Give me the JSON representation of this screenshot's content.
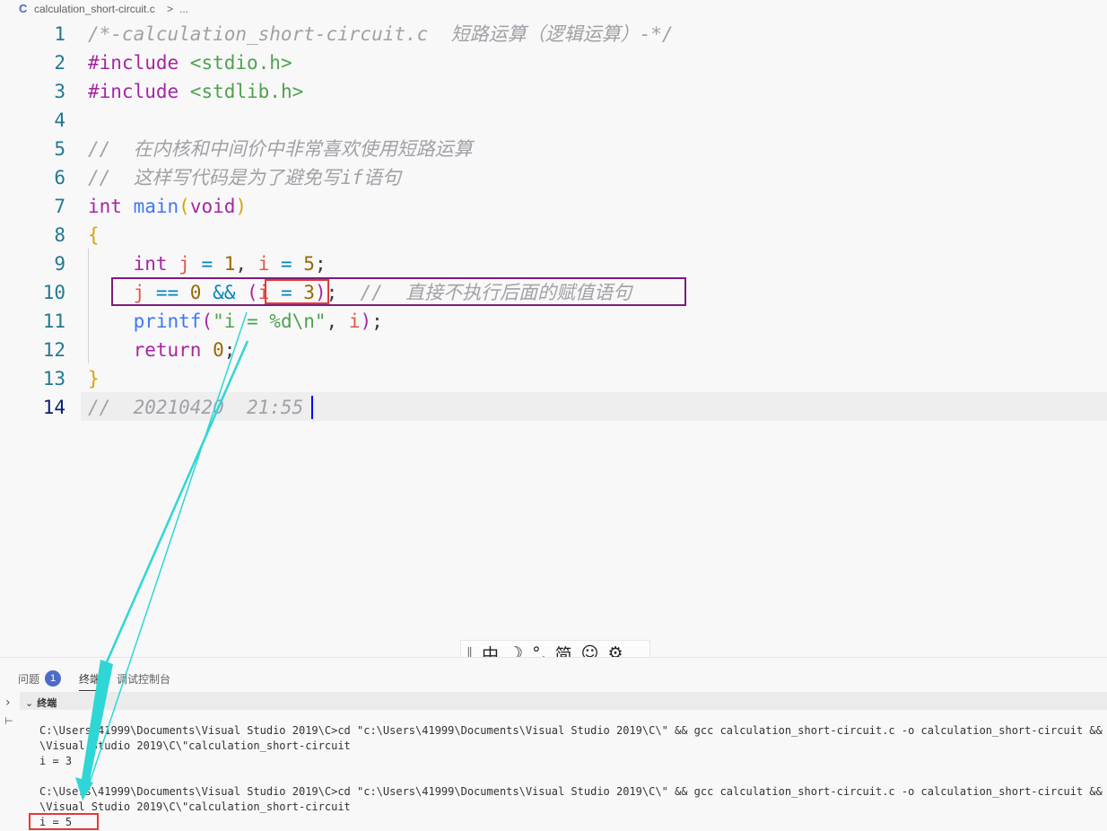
{
  "breadcrumb": {
    "file_icon": "C",
    "file": "calculation_short-circuit.c",
    "separator": ">",
    "more": "..."
  },
  "editor": {
    "active_line": 14,
    "lines": [
      {
        "n": "1",
        "tokens": [
          {
            "t": "/*-calculation_short-circuit.c  短路运算（逻辑运算）-*/",
            "c": "cm"
          }
        ]
      },
      {
        "n": "2",
        "tokens": [
          {
            "t": "#include ",
            "c": "pp"
          },
          {
            "t": "<stdio.h>",
            "c": "str"
          }
        ]
      },
      {
        "n": "3",
        "tokens": [
          {
            "t": "#include ",
            "c": "pp"
          },
          {
            "t": "<stdlib.h>",
            "c": "str"
          }
        ]
      },
      {
        "n": "4",
        "tokens": []
      },
      {
        "n": "5",
        "tokens": [
          {
            "t": "//  在内核和中间价中非常喜欢使用短路运算",
            "c": "cm"
          }
        ]
      },
      {
        "n": "6",
        "tokens": [
          {
            "t": "//  这样写代码是为了避免写if语句",
            "c": "cm"
          }
        ]
      },
      {
        "n": "7",
        "tokens": [
          {
            "t": "int ",
            "c": "kw"
          },
          {
            "t": "main",
            "c": "fn"
          },
          {
            "t": "(",
            "c": "br1"
          },
          {
            "t": "void",
            "c": "kw"
          },
          {
            "t": ")",
            "c": "br1"
          }
        ]
      },
      {
        "n": "8",
        "tokens": [
          {
            "t": "{",
            "c": "br1"
          }
        ]
      },
      {
        "n": "9",
        "tokens": [
          {
            "t": "    int ",
            "c": "kw"
          },
          {
            "t": "j",
            "c": "var"
          },
          {
            "t": " = ",
            "c": "op"
          },
          {
            "t": "1",
            "c": "num"
          },
          {
            "t": ", ",
            "c": "plain"
          },
          {
            "t": "i",
            "c": "var"
          },
          {
            "t": " = ",
            "c": "op"
          },
          {
            "t": "5",
            "c": "num"
          },
          {
            "t": ";",
            "c": "plain"
          }
        ]
      },
      {
        "n": "10",
        "tokens": [
          {
            "t": "    j",
            "c": "var"
          },
          {
            "t": " == ",
            "c": "op"
          },
          {
            "t": "0",
            "c": "num"
          },
          {
            "t": " && ",
            "c": "op"
          },
          {
            "t": "(",
            "c": "br2"
          },
          {
            "t": "i",
            "c": "var"
          },
          {
            "t": " = ",
            "c": "op"
          },
          {
            "t": "3",
            "c": "num"
          },
          {
            "t": ")",
            "c": "br2"
          },
          {
            "t": ";  ",
            "c": "plain"
          },
          {
            "t": "//  直接不执行后面的赋值语句",
            "c": "cm"
          }
        ]
      },
      {
        "n": "11",
        "tokens": [
          {
            "t": "    printf",
            "c": "fn"
          },
          {
            "t": "(",
            "c": "br2"
          },
          {
            "t": "\"i = %d\\n\"",
            "c": "str"
          },
          {
            "t": ", ",
            "c": "plain"
          },
          {
            "t": "i",
            "c": "var"
          },
          {
            "t": ")",
            "c": "br2"
          },
          {
            "t": ";",
            "c": "plain"
          }
        ]
      },
      {
        "n": "12",
        "tokens": [
          {
            "t": "    return ",
            "c": "kw"
          },
          {
            "t": "0",
            "c": "num"
          },
          {
            "t": ";",
            "c": "plain"
          }
        ]
      },
      {
        "n": "13",
        "tokens": [
          {
            "t": "}",
            "c": "br1"
          }
        ]
      },
      {
        "n": "14",
        "tokens": [
          {
            "t": "//  20210420  21:55",
            "c": "cm"
          }
        ]
      }
    ]
  },
  "ime_toolbar": {
    "grip": "‖",
    "mode": "中",
    "moon": "☽",
    "punct": "°,",
    "simplified": "简",
    "emoji": "☺",
    "settings": "⚙"
  },
  "panel": {
    "tabs": {
      "problems": "问题",
      "problems_count": "1",
      "terminal": "终端",
      "debug_console": "调试控制台"
    },
    "terminal_title": "终端",
    "lines": [
      "C:\\Users\\41999\\Documents\\Visual Studio 2019\\C>cd \"c:\\Users\\41999\\Documents\\Visual Studio 2019\\C\\\" && gcc calculation_short-circuit.c -o calculation_short-circuit && \"c:\\U",
      "\\Visual Studio 2019\\C\\\"calculation_short-circuit",
      "i = 3",
      "",
      "C:\\Users\\41999\\Documents\\Visual Studio 2019\\C>cd \"c:\\Users\\41999\\Documents\\Visual Studio 2019\\C\\\" && gcc calculation_short-circuit.c -o calculation_short-circuit && \"c:\\U",
      "\\Visual Studio 2019\\C\\\"calculation_short-circuit",
      "i = 5"
    ]
  },
  "colors": {
    "highlight_box": "#7b1e7a",
    "red_box": "#e53935",
    "arrow": "#2fd6d6"
  }
}
